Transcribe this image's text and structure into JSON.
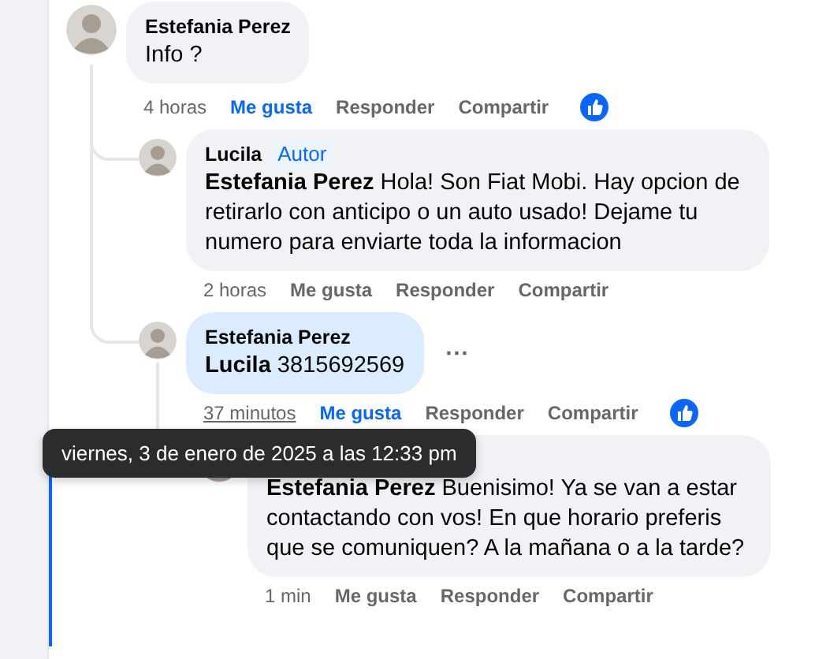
{
  "comments": [
    {
      "author": "Estefania Perez",
      "text": "Info ?",
      "highlighted": false,
      "time": "4 horas",
      "time_hovered": false,
      "liked": true,
      "reacted": true,
      "actions": [
        "Me gusta",
        "Responder",
        "Compartir"
      ],
      "children": [
        {
          "author": "Lucila",
          "author_badge": "Autor",
          "text": "**Estefania Perez** Hola! Son Fiat Mobi. Hay opcion de retirarlo con anticipo o un auto usado! Dejame tu numero para enviarte toda la informacion",
          "highlighted": false,
          "time": "2 horas",
          "time_hovered": false,
          "liked": false,
          "reacted": false,
          "actions": [
            "Me gusta",
            "Responder",
            "Compartir"
          ]
        },
        {
          "author": "Estefania Perez",
          "text": "**Lucila** 3815692569",
          "highlighted": true,
          "more": "···",
          "time": "37 minutos",
          "time_hovered": true,
          "liked": true,
          "reacted": true,
          "actions": [
            "Me gusta",
            "Responder",
            "Compartir"
          ],
          "children": [
            {
              "text": "**Estefania Perez** Buenisimo! Ya se van a estar contactando con vos! En que horario preferis que se comuniquen? A la mañana o a la tarde?",
              "highlighted": false,
              "time": "1 min",
              "time_hovered": false,
              "liked": false,
              "reacted": false,
              "actions": [
                "Me gusta",
                "Responder",
                "Compartir"
              ]
            }
          ]
        }
      ]
    }
  ],
  "tooltip": {
    "text": "viernes, 3 de enero de 2025 a las 12:33 pm"
  }
}
